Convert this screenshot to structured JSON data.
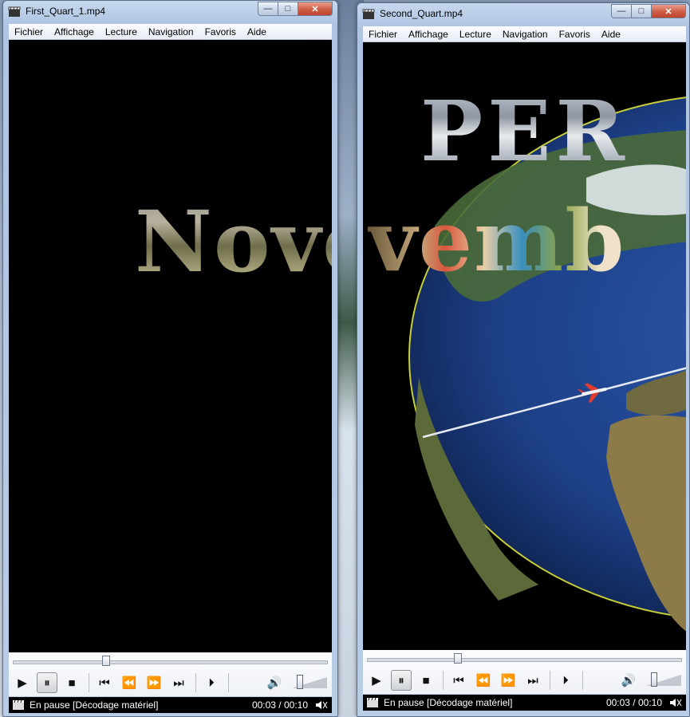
{
  "windows": [
    {
      "title": "First_Quart_1.mp4",
      "menu": [
        "Fichier",
        "Affichage",
        "Lecture",
        "Navigation",
        "Favoris",
        "Aide"
      ],
      "overlay_text": "Nove",
      "status": "En pause [Décodage matériel]",
      "time": "00:03 / 00:10",
      "progress": 0.3
    },
    {
      "title": "Second_Quart.mp4",
      "menu": [
        "Fichier",
        "Affichage",
        "Lecture",
        "Navigation",
        "Favoris",
        "Aide"
      ],
      "overlay_top": "PER",
      "overlay_text": "vemb",
      "status": "En pause [Décodage matériel]",
      "time": "00:03 / 00:10",
      "progress": 0.3
    }
  ],
  "icons": {
    "app": "clapperboard-icon",
    "play": "▶",
    "pause": "⏸",
    "stop": "■",
    "prev": "⏮",
    "rewind": "⏪",
    "forward": "⏩",
    "next": "⏭",
    "frame_step": "⏵",
    "volume": "🔊",
    "minimize": "—",
    "maximize": "□",
    "close": "✕",
    "audio_status": "speaker-status-icon"
  },
  "colors": {
    "video_bg": "#000000",
    "status_bg": "#000000",
    "status_text": "#ffffff",
    "ocean": "#1d3f86"
  }
}
